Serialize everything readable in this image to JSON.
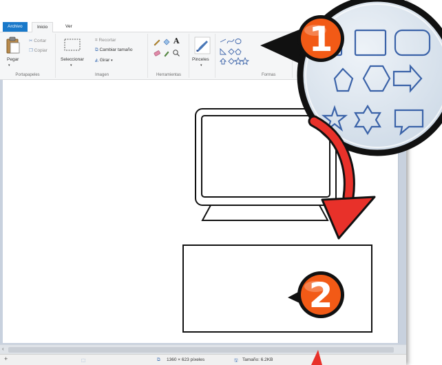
{
  "menu": {
    "file": "Archivo",
    "home": "Inicio",
    "view": "Ver"
  },
  "ribbon": {
    "clipboard": {
      "paste": "Pegar",
      "cut": "Cortar",
      "copy": "Copiar",
      "label": "Portapapeles"
    },
    "image": {
      "select": "Seleccionar",
      "crop": "Recortar",
      "resize": "Cambiar tamaño",
      "rotate": "Girar",
      "label": "Imagen"
    },
    "tools": {
      "label": "Herramientas",
      "text_glyph": "A"
    },
    "brushes": {
      "label": "Pinceles"
    },
    "shapes": {
      "label": "Formas"
    }
  },
  "status": {
    "dimensions": "1360 × 623 píxeles",
    "size": "Tamaño: 6.2KB"
  },
  "callouts": {
    "one": "1",
    "two": "2"
  },
  "colors": {
    "accent": "#1979ca",
    "callout_orange": "#f25a16",
    "arrow_red": "#e8312a"
  }
}
